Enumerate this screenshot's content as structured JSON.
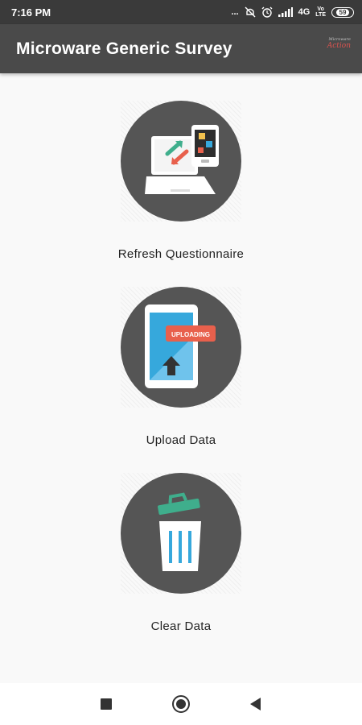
{
  "status_bar": {
    "time": "7:16 PM",
    "dots": "...",
    "network": "4G",
    "volte_top": "Vo",
    "volte_bottom": "LTE",
    "battery": "59",
    "icons": [
      "dots-icon",
      "mute-icon",
      "alarm-icon",
      "signal-icon",
      "volte-icon",
      "battery-icon"
    ]
  },
  "app_bar": {
    "title": "Microware Generic Survey",
    "logo_small": "Microware",
    "logo_text": "Action"
  },
  "menu": [
    {
      "label": "Refresh Questionnaire",
      "icon": "laptop-phone-sync-icon"
    },
    {
      "label": "Upload Data",
      "icon": "tablet-upload-icon",
      "badge": "UPLOADING"
    },
    {
      "label": "Clear Data",
      "icon": "trash-bin-icon"
    }
  ],
  "nav_bar": {
    "icons": [
      "recents-square-icon",
      "home-circle-icon",
      "back-triangle-icon"
    ]
  },
  "colors": {
    "status_bar": "#3a3a3a",
    "app_bar": "#4a4a4a",
    "circle": "#555555",
    "accent_red": "#e8604c",
    "accent_green": "#3fae8c",
    "accent_blue": "#36a8dc"
  }
}
